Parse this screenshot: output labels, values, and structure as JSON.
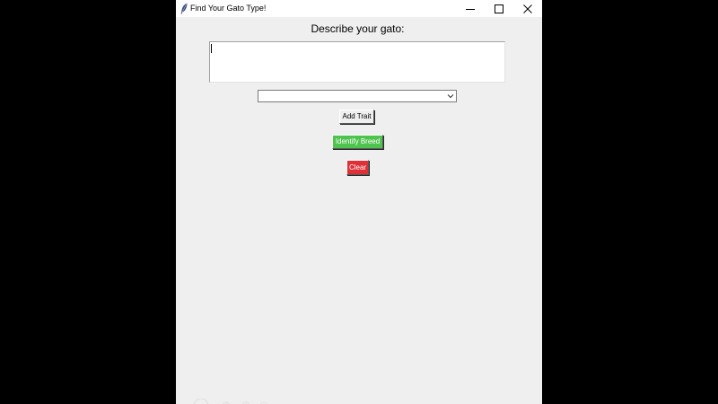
{
  "window": {
    "title": "Find Your Gato Type!",
    "icon": "feather-icon",
    "controls": [
      "minimize-icon",
      "maximize-icon",
      "close-icon"
    ]
  },
  "form": {
    "prompt_label": "Describe your gato:",
    "description_value": "",
    "trait_selected": "",
    "add_trait_label": "Add Trait",
    "identify_label": "Identify Breed",
    "clear_label": "Clear"
  },
  "colors": {
    "window_bg": "#f0eff0",
    "identify_bg": "#4ec44e",
    "clear_bg": "#dd3037",
    "screen_bg": "#000000"
  }
}
